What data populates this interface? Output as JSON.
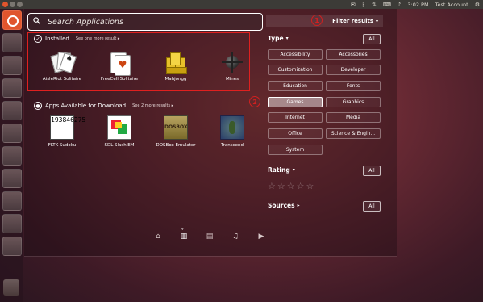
{
  "panel": {
    "time": "3:02 PM",
    "user": "Test Account"
  },
  "search": {
    "placeholder": "Search Applications"
  },
  "filter_button": {
    "label": "Filter results"
  },
  "installed": {
    "title": "Installed",
    "more": "See one more result",
    "apps": [
      {
        "name": "AisleRiot Solitaire",
        "icon": "cards-icon"
      },
      {
        "name": "FreeCell Solitaire",
        "icon": "freecell-icon"
      },
      {
        "name": "Mahjongg",
        "icon": "mahjongg-icon"
      },
      {
        "name": "Mines",
        "icon": "mine-icon"
      }
    ]
  },
  "available": {
    "title": "Apps Available for Download",
    "more": "See 2 more results",
    "apps": [
      {
        "name": "FLTK Sudoku",
        "icon": "sudoku-icon",
        "digits": "193846275"
      },
      {
        "name": "SDL Slash'EM",
        "icon": "slashem-icon"
      },
      {
        "name": "DOSBox Emulator",
        "icon": "dosbox-icon",
        "mark": "DOSBOX"
      },
      {
        "name": "Transcend",
        "icon": "transcend-icon"
      }
    ]
  },
  "filters": {
    "type_label": "Type",
    "all_label": "All",
    "categories": [
      "Accessibility",
      "Accessories",
      "Customization",
      "Developer",
      "Education",
      "Fonts",
      "Games",
      "Graphics",
      "Internet",
      "Media",
      "Office",
      "Science & Engin...",
      "System"
    ],
    "selected": "Games",
    "rating_label": "Rating",
    "sources_label": "Sources"
  },
  "callouts": {
    "first": "1",
    "second": "2"
  },
  "lenses": [
    "home-lens-icon",
    "apps-lens-icon",
    "files-lens-icon",
    "music-lens-icon",
    "video-lens-icon"
  ],
  "colors": {
    "accent": "#e0552d",
    "annotation": "#e0201f"
  }
}
